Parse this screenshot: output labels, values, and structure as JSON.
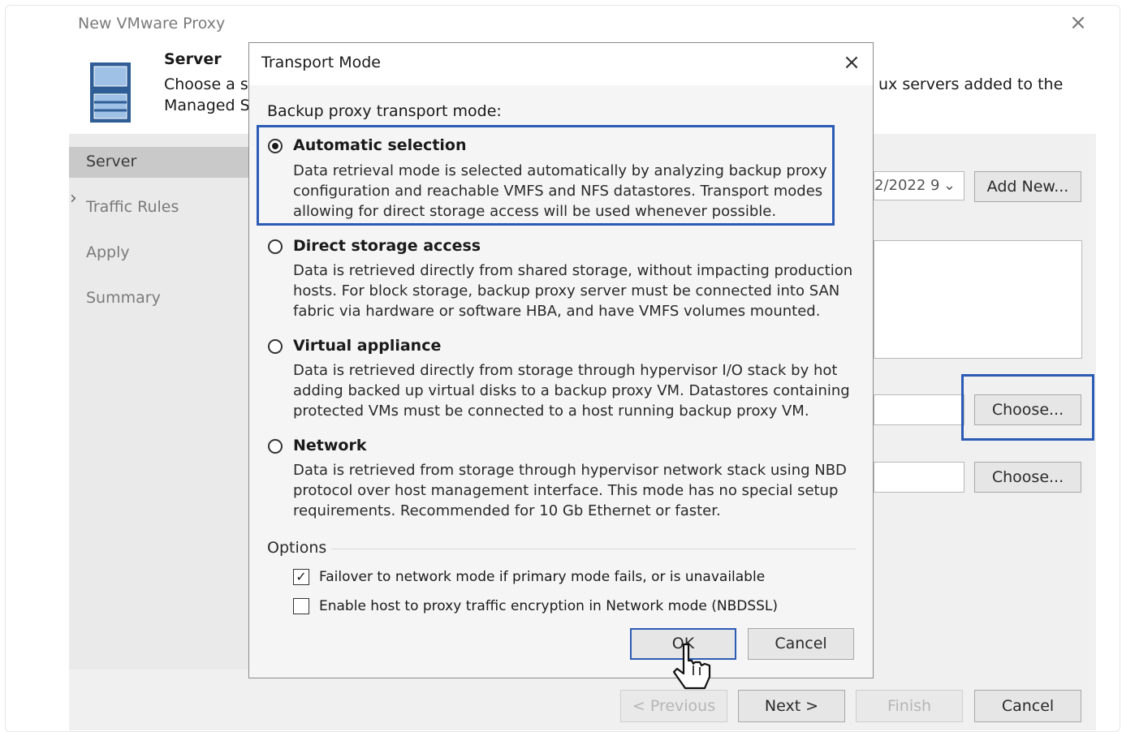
{
  "wizard": {
    "title": "New VMware Proxy",
    "close_glyph": "×",
    "header": {
      "title": "Server",
      "desc_line1": "Choose a se",
      "desc_line2": "Managed Se",
      "desc_right": "ux servers added to the"
    },
    "nav": {
      "items": [
        {
          "label": "Server",
          "selected": true
        },
        {
          "label": "Traffic Rules"
        },
        {
          "label": "Apply"
        },
        {
          "label": "Summary"
        }
      ]
    },
    "background": {
      "select_value": "2/2022 9",
      "add_new_label": "Add New...",
      "choose1_label": "Choose...",
      "choose2_label": "Choose..."
    },
    "footer": {
      "previous_label": "< Previous",
      "next_label": "Next >",
      "finish_label": "Finish",
      "cancel_label": "Cancel"
    }
  },
  "dialog": {
    "title": "Transport Mode",
    "close_glyph": "×",
    "prompt": "Backup proxy transport mode:",
    "options": [
      {
        "title": "Automatic selection",
        "selected": true,
        "desc": [
          "Data retrieval mode is selected automatically by analyzing backup proxy",
          "configuration and reachable VMFS and NFS datastores. Transport modes",
          "allowing for direct storage access will be used whenever possible."
        ]
      },
      {
        "title": "Direct storage access",
        "selected": false,
        "desc": [
          "Data is retrieved directly from shared storage, without impacting production",
          "hosts. For block storage, backup proxy server must be connected into SAN",
          "fabric via hardware or software HBA, and have VMFS volumes mounted."
        ]
      },
      {
        "title": "Virtual appliance",
        "selected": false,
        "desc": [
          "Data is retrieved directly from storage through hypervisor I/O stack by hot",
          "adding backed up virtual disks to a backup proxy VM. Datastores containing",
          "protected VMs must be connected to a host running backup proxy VM."
        ]
      },
      {
        "title": "Network",
        "selected": false,
        "desc": [
          "Data is retrieved from storage through hypervisor network stack using NBD",
          "protocol over host management interface. This mode has no special setup",
          "requirements. Recommended for 10 Gb Ethernet or faster."
        ]
      }
    ],
    "options_group_label": "Options",
    "checkboxes": [
      {
        "label": "Failover to network mode if primary mode fails, or is unavailable",
        "checked": true
      },
      {
        "label": "Enable host to proxy traffic encryption in Network mode (NBDSSL)",
        "checked": false
      }
    ],
    "ok_label": "OK",
    "cancel_label": "Cancel"
  },
  "colors": {
    "highlight": "#2b5bb5",
    "nav_selected": "#c9c9c9",
    "dialog_bg": "#f5f5f5"
  }
}
